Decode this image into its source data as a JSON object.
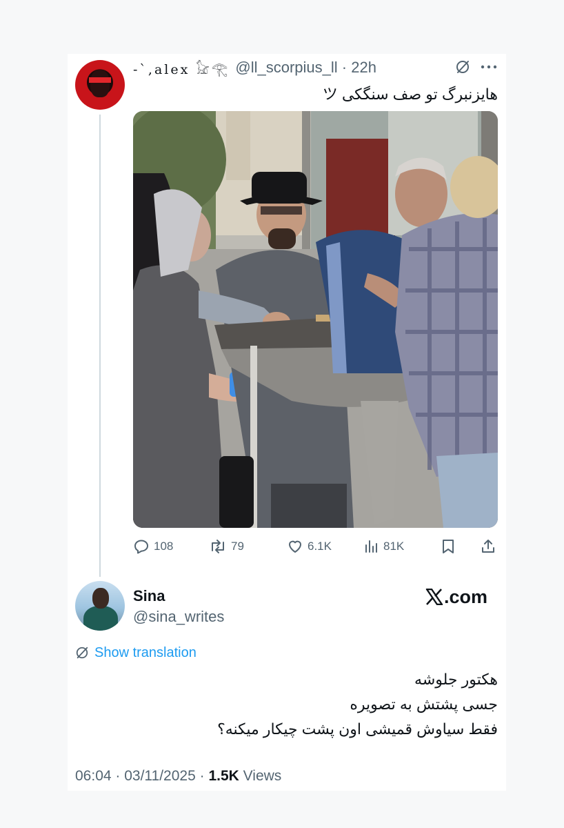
{
  "quoted_tweet": {
    "display_name": "-`,alex 𓃠𓂀",
    "handle": "@ll_scorpius_ll",
    "time": "22h",
    "text": "هایزنبرگ تو صف سنگکی ツ",
    "metrics": {
      "replies": "108",
      "retweets": "79",
      "likes": "6.1K",
      "views": "81K"
    }
  },
  "main_tweet": {
    "display_name": "Sina",
    "handle": "@sina_writes",
    "brand": ".com",
    "show_translation": "Show translation",
    "lines": [
      "هکتور جلوشه",
      "جسی پشتش به تصویره",
      "فقط سیاوش قمیشی اون پشت چیکار میکنه؟"
    ],
    "time": "06:04",
    "date": "03/11/2025",
    "views_count": "1.5K",
    "views_label": "Views"
  },
  "colors": {
    "text_primary": "#0f1419",
    "text_secondary": "#536471",
    "link": "#1d9bf0",
    "thread_line": "#cfd9de"
  }
}
